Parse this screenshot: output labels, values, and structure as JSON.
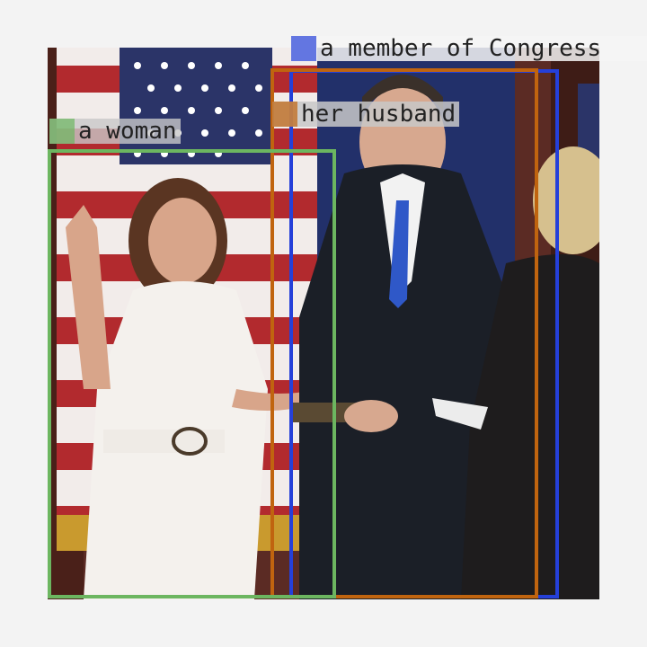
{
  "image": {
    "description_icon": "photo-icon"
  },
  "detections": [
    {
      "label": "a member of Congress",
      "color": "#2540d9",
      "tag_bg": "rgba(245,245,245,0.85)"
    },
    {
      "label": "her husband",
      "color": "#c0640f",
      "tag_bg": "rgba(200,200,200,0.85)"
    },
    {
      "label": "a woman",
      "color": "#6cb660",
      "tag_bg": "rgba(200,200,200,0.80)"
    }
  ]
}
